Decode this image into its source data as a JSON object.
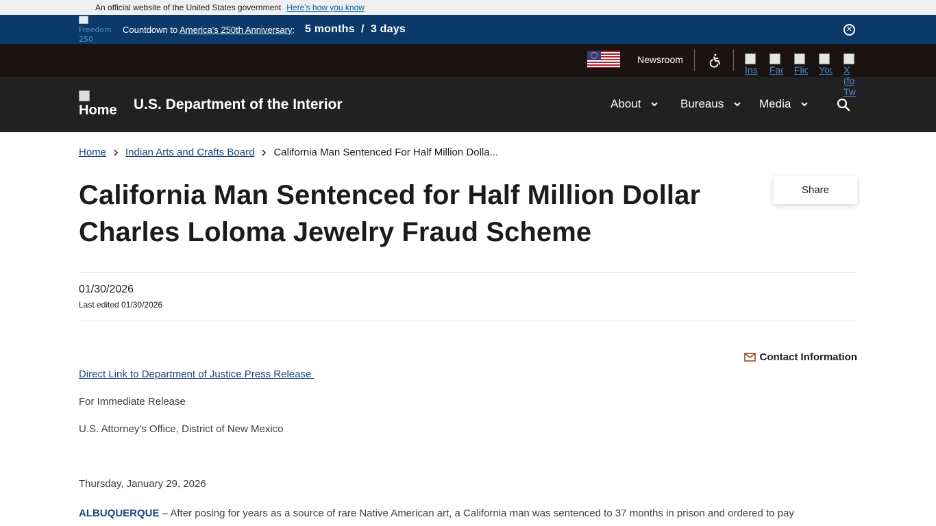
{
  "gov_banner": {
    "text": "An official website of the United States government",
    "link": "Here's how you know"
  },
  "countdown": {
    "logo_alt": "Freedom 250",
    "prefix": "Countdown to ",
    "link": "America's 250th Anniversary",
    "suffix": ":",
    "timer": "5 months  /  3 days"
  },
  "utility": {
    "newsroom": "Newsroom",
    "social": [
      "Ins",
      "Fac",
      "Flic",
      "You",
      "X (fo Tw"
    ]
  },
  "header": {
    "home_label": "Home",
    "site_title": "U.S. Department of the Interior",
    "nav": [
      "About",
      "Bureaus",
      "Media"
    ]
  },
  "breadcrumb": {
    "home": "Home",
    "section": "Indian Arts and Crafts Board",
    "current": "California Man Sentenced For Half Million Dolla..."
  },
  "article": {
    "title": "California Man Sentenced for Half Million Dollar Charles Loloma Jewelry Fraud Scheme",
    "share": "Share",
    "date": "01/30/2026",
    "last_edited": "Last edited 01/30/2026",
    "contact": "Contact Information",
    "doj_link": "Direct Link to Department of Justice Press Release ",
    "release": "For Immediate Release",
    "office": "U.S. Attorney's Office, District of New Mexico",
    "day": "Thursday, January 29, 2026",
    "dateline": "ALBUQUERQUE",
    "lead": " – After posing for years as a source of rare Native American art, a California man was sentenced to 37 months in prison and ordered to pay"
  }
}
